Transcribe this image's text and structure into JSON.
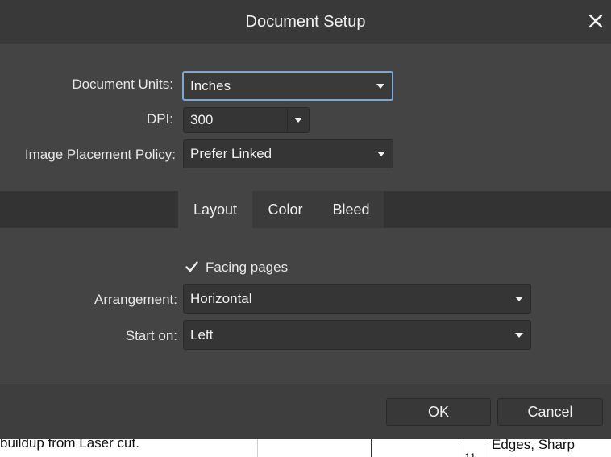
{
  "dialog": {
    "title": "Document Setup",
    "close_glyph": "✕"
  },
  "document_units": {
    "label": "Document Units:",
    "value": "Inches"
  },
  "dpi": {
    "label": "DPI:",
    "value": "300"
  },
  "image_placement": {
    "label": "Image Placement Policy:",
    "value": "Prefer Linked"
  },
  "tabs": [
    {
      "label": "Layout",
      "active": true
    },
    {
      "label": "Color",
      "active": false
    },
    {
      "label": "Bleed",
      "active": false
    }
  ],
  "layout": {
    "facing_pages": {
      "label": "Facing pages",
      "checked": true
    },
    "arrangement": {
      "label": "Arrangement:",
      "value": "Horizontal"
    },
    "start_on": {
      "label": "Start on:",
      "value": "Left"
    }
  },
  "buttons": {
    "ok": "OK",
    "cancel": "Cancel"
  },
  "background_document": {
    "left_text": "buildup from Laser cut.",
    "number_text": "11",
    "right_text": "Edges, Sharp"
  },
  "icons": {
    "close": "close-icon",
    "dropdown": "chevron-down-icon",
    "check": "checkmark-icon"
  },
  "colors": {
    "dialog_bg": "#444444",
    "titlebar_bg": "#393939",
    "focus_border": "#7aa7d6"
  }
}
